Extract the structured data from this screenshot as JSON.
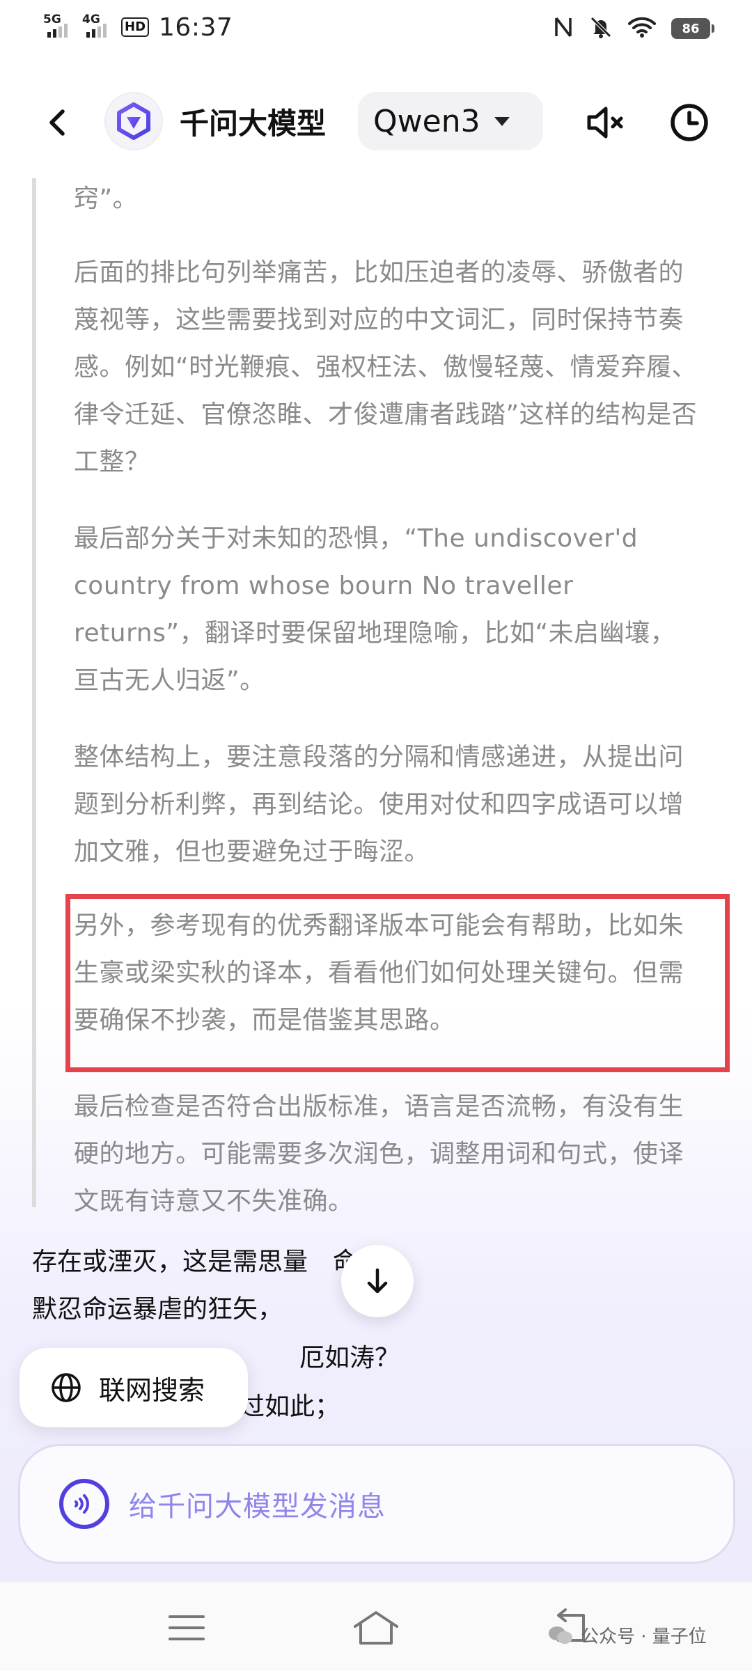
{
  "status_bar": {
    "net1": "5G",
    "net2": "4G",
    "hd": "HD",
    "time": "16:37",
    "battery": "86"
  },
  "header": {
    "app_title": "千问大模型",
    "model": "Qwen3"
  },
  "thinking": {
    "p0": "窍”。",
    "p1": "后面的排比句列举痛苦，比如压迫者的凌辱、骄傲者的蔑视等，这些需要找到对应的中文词汇，同时保持节奏感。例如“时光鞭痕、强权枉法、傲慢轻蔑、情爱弃履、律令迁延、官僚恣睢、才俊遭庸者践踏”这样的结构是否工整？",
    "p2": "最后部分关于对未知的恐惧，“The undiscover'd country from whose bourn No traveller returns”，翻译时要保留地理隐喻，比如“未启幽壤，亘古无人归返”。",
    "p3": "整体结构上，要注意段落的分隔和情感递进，从提出问题到分析利弊，再到结论。使用对仗和四字成语可以增加文雅，但也要避免过于晦涩。",
    "p4": "另外，参考现有的优秀翻译版本可能会有帮助，比如朱生豪或梁实秋的译本，看看他们如何处理关键句。但需要确保不抄袭，而是借鉴其思路。",
    "p5": "最后检查是否符合出版标准，语言是否流畅，有没有生硬的地方。可能需要多次润色，调整用词和句式，使译文既有诗意又不失准确。"
  },
  "answer": {
    "line1": "存在或湮灭，这是需思量",
    "line1_tail": "命题：",
    "line2": "默忍命运暴虐的狂矢，",
    "line3": "厄如涛？",
    "line4": "过如此；"
  },
  "web_search_label": "联网搜索",
  "input": {
    "placeholder": "给千问大模型发消息"
  },
  "watermark": "公众号 · 量子位",
  "colors": {
    "accent": "#5140de",
    "highlight_border": "#e5434c",
    "thinking_text": "#8a8a8a"
  }
}
